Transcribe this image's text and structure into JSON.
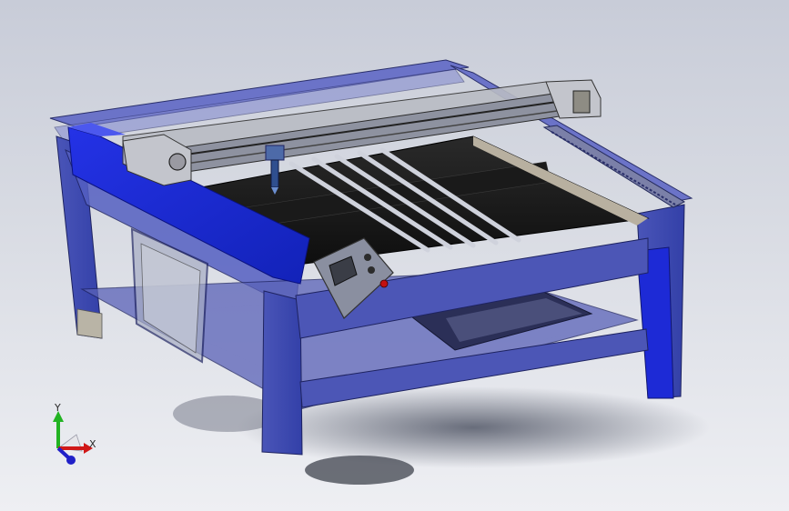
{
  "viewport": {
    "background_top": "#c8ccd8",
    "background_bottom": "#eeeff3"
  },
  "model": {
    "frame_color": "#3d4ab8",
    "side_rail_color": "#1d2ad6",
    "bed_color": "#141414",
    "gantry_color": "#b9bcc4",
    "control_panel_color": "#8a8fa0",
    "estop_color": "#c21010"
  },
  "triad": {
    "y_label": "Y",
    "x_label": "X",
    "y_color": "#22b322",
    "x_color": "#d01818",
    "z_color": "#2020c8"
  }
}
